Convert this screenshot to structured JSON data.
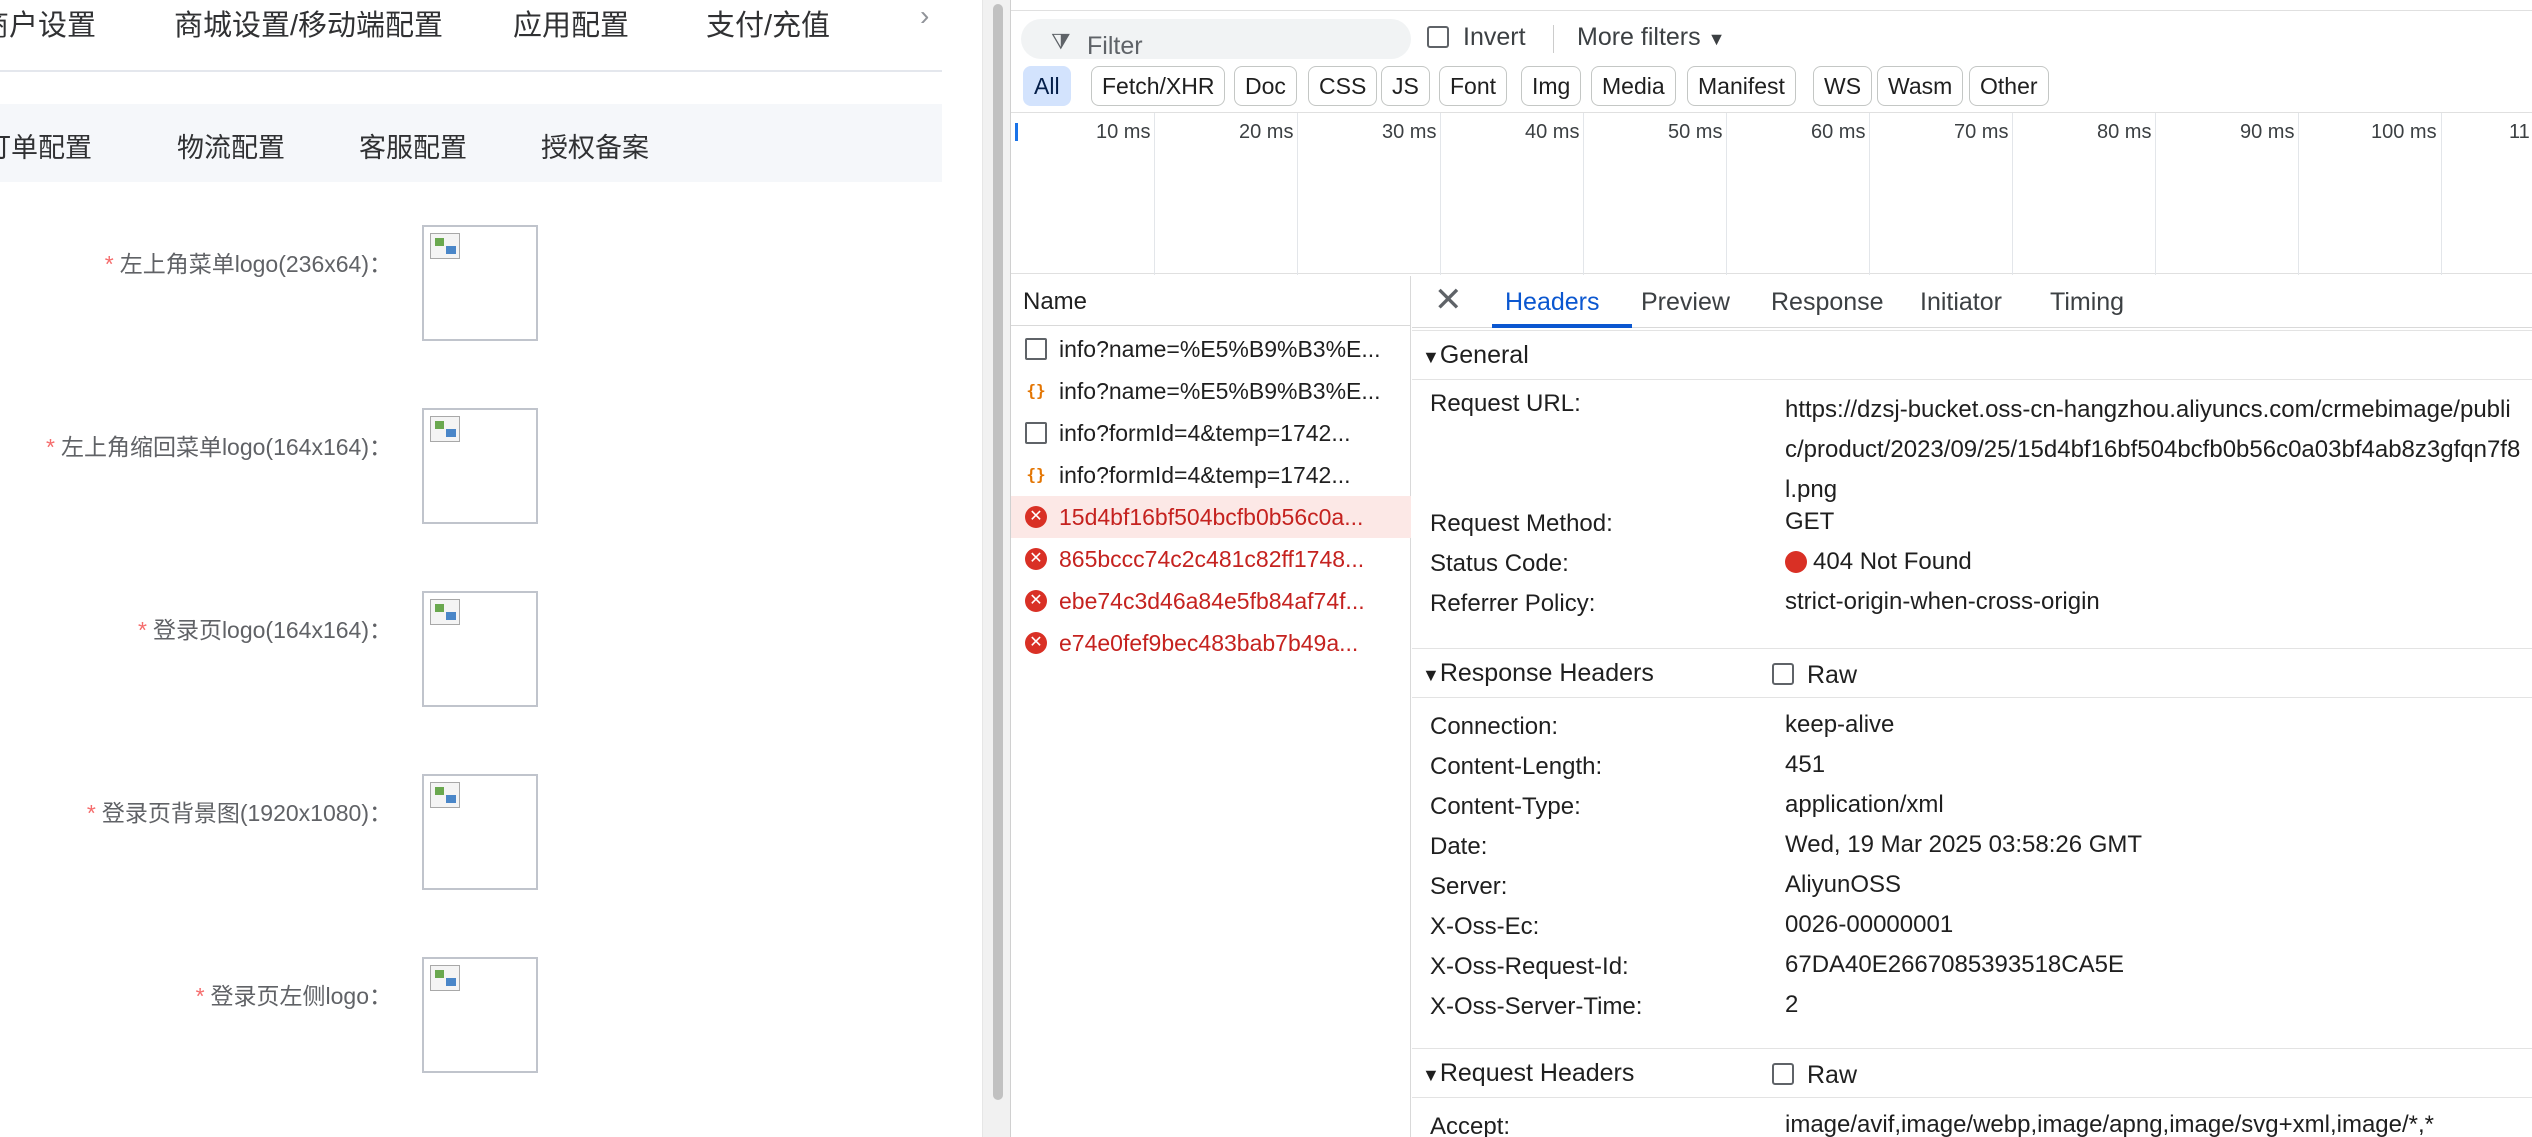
{
  "app": {
    "top_tabs": [
      "商户设置",
      "商城设置/移动端配置",
      "应用配置",
      "支付/充值"
    ],
    "top_tabs_arrow": "›",
    "sub_tabs": [
      "订单配置",
      "物流配置",
      "客服配置",
      "授权备案"
    ],
    "form_required_mark": "*",
    "form_fields": [
      {
        "label": "左上角菜单logo(236x64)："
      },
      {
        "label": "左上角缩回菜单logo(164x164)："
      },
      {
        "label": "登录页logo(164x164)："
      },
      {
        "label": "登录页背景图(1920x1080)："
      },
      {
        "label": "登录页左侧logo："
      }
    ]
  },
  "devtools": {
    "filter": {
      "placeholder": "Filter",
      "invert_label": "Invert",
      "more_filters_label": "More filters"
    },
    "type_filters": [
      "All",
      "Fetch/XHR",
      "Doc",
      "CSS",
      "JS",
      "Font",
      "Img",
      "Media",
      "Manifest",
      "WS",
      "Wasm",
      "Other"
    ],
    "active_type_filter": "All",
    "timeline_ticks": [
      "10 ms",
      "20 ms",
      "30 ms",
      "40 ms",
      "50 ms",
      "60 ms",
      "70 ms",
      "80 ms",
      "90 ms",
      "100 ms",
      "11"
    ],
    "name_column_header": "Name",
    "requests": [
      {
        "name": "info?name=%E5%B9%B3%E...",
        "type": "doc",
        "error": false
      },
      {
        "name": "info?name=%E5%B9%B3%E...",
        "type": "json",
        "error": false
      },
      {
        "name": "info?formId=4&temp=1742...",
        "type": "doc",
        "error": false
      },
      {
        "name": "info?formId=4&temp=1742...",
        "type": "json",
        "error": false
      },
      {
        "name": "15d4bf16bf504bcfb0b56c0a...",
        "type": "err",
        "error": true,
        "selected": true
      },
      {
        "name": "865bccc74c2c481c82ff1748...",
        "type": "err",
        "error": true
      },
      {
        "name": "ebe74c3d46a84e5fb84af74f...",
        "type": "err",
        "error": true
      },
      {
        "name": "e74e0fef9bec483bab7b49a...",
        "type": "err",
        "error": true
      }
    ],
    "detail_tabs": [
      "Headers",
      "Preview",
      "Response",
      "Initiator",
      "Timing"
    ],
    "active_detail_tab": "Headers",
    "close_glyph": "✕",
    "raw_label": "Raw",
    "general": {
      "title": "General",
      "rows": [
        {
          "key": "Request URL:",
          "value": "https://dzsj-bucket.oss-cn-hangzhou.aliyuncs.com/crmebimage/public/product/2023/09/25/15d4bf16bf504bcfb0b56c0a03bf4ab8z3gfqn7f8l.png"
        },
        {
          "key": "Request Method:",
          "value": "GET"
        },
        {
          "key": "Status Code:",
          "value": "404 Not Found"
        },
        {
          "key": "Referrer Policy:",
          "value": "strict-origin-when-cross-origin"
        }
      ]
    },
    "response_headers": {
      "title": "Response Headers",
      "rows": [
        {
          "key": "Connection:",
          "value": "keep-alive"
        },
        {
          "key": "Content-Length:",
          "value": "451"
        },
        {
          "key": "Content-Type:",
          "value": "application/xml"
        },
        {
          "key": "Date:",
          "value": "Wed, 19 Mar 2025 03:58:26 GMT"
        },
        {
          "key": "Server:",
          "value": "AliyunOSS"
        },
        {
          "key": "X-Oss-Ec:",
          "value": "0026-00000001"
        },
        {
          "key": "X-Oss-Request-Id:",
          "value": "67DA40E2667085393518CA5E"
        },
        {
          "key": "X-Oss-Server-Time:",
          "value": "2"
        }
      ]
    },
    "request_headers": {
      "title": "Request Headers",
      "rows": [
        {
          "key": "Accept:",
          "value": "image/avif,image/webp,image/apng,image/svg+xml,image/*,*"
        }
      ]
    }
  }
}
